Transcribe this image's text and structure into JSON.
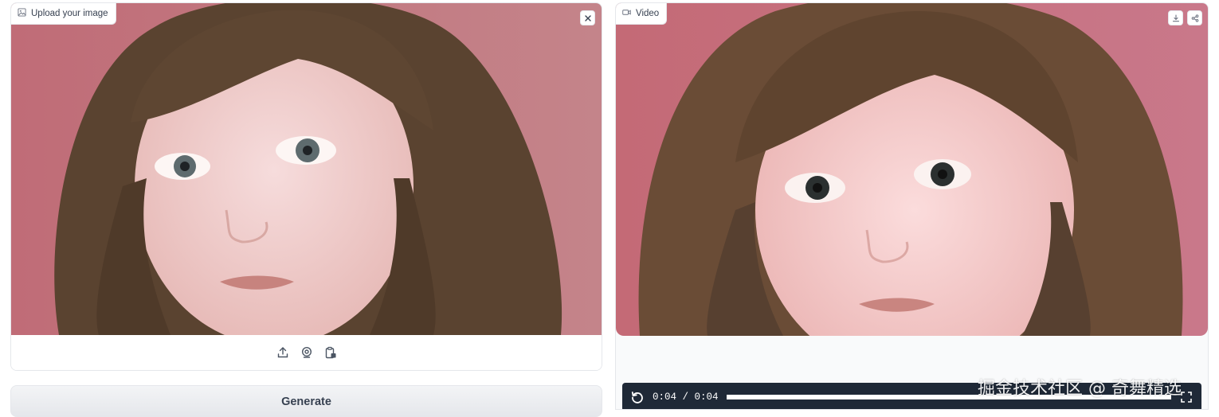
{
  "input": {
    "label": "Upload your image",
    "label_icon": "image-icon",
    "clear_icon": "close-icon",
    "sources": [
      {
        "name": "upload-icon"
      },
      {
        "name": "webcam-icon"
      },
      {
        "name": "clipboard-icon"
      }
    ]
  },
  "actions": {
    "generate_label": "Generate"
  },
  "output": {
    "label": "Video",
    "label_icon": "video-icon",
    "download_icon": "download-icon",
    "share_icon": "share-icon",
    "player": {
      "replay_icon": "replay-icon",
      "time": "0:04 / 0:04",
      "progress": 1.0,
      "fullscreen_icon": "fullscreen-icon"
    }
  },
  "watermark": "掘金技术社区 @ 奇舞精选",
  "colors": {
    "background_pink": "#c8787f",
    "controls_dark": "#1f2937"
  }
}
